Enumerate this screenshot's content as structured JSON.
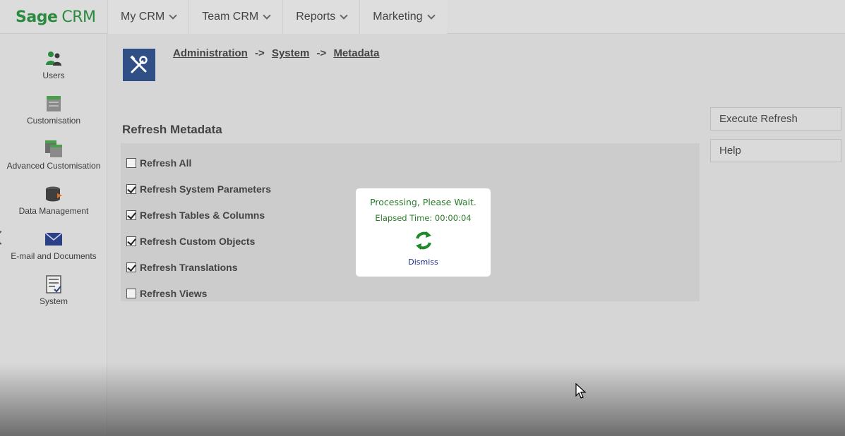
{
  "app": {
    "brand": "Sage",
    "brand_suffix": "CRM"
  },
  "nav": {
    "items": [
      {
        "label": "My CRM"
      },
      {
        "label": "Team CRM"
      },
      {
        "label": "Reports"
      },
      {
        "label": "Marketing"
      }
    ]
  },
  "sidebar": {
    "items": [
      {
        "label": "Users",
        "icon": "users-icon"
      },
      {
        "label": "Customisation",
        "icon": "customisation-icon"
      },
      {
        "label": "Advanced Customisation",
        "icon": "advanced-customisation-icon"
      },
      {
        "label": "Data Management",
        "icon": "data-management-icon"
      },
      {
        "label": "E-mail and Documents",
        "icon": "envelope-icon"
      },
      {
        "label": "System",
        "icon": "system-icon"
      }
    ]
  },
  "breadcrumb": {
    "items": [
      "Administration",
      "System",
      "Metadata"
    ],
    "separator": "->"
  },
  "section": {
    "title": "Refresh Metadata"
  },
  "options": [
    {
      "label": "Refresh All",
      "checked": false
    },
    {
      "label": "Refresh System Parameters",
      "checked": true
    },
    {
      "label": "Refresh Tables & Columns",
      "checked": true
    },
    {
      "label": "Refresh Custom Objects",
      "checked": true
    },
    {
      "label": "Refresh Translations",
      "checked": true
    },
    {
      "label": "Refresh Views",
      "checked": false
    }
  ],
  "actions": {
    "execute_label": "Execute Refresh",
    "help_label": "Help"
  },
  "modal": {
    "message": "Processing, Please Wait.",
    "elapsed": "Elapsed Time: 00:00:04",
    "dismiss_label": "Dismiss"
  },
  "colors": {
    "brand_green": "#2a8a3e",
    "admin_icon_bg": "#2f4f86",
    "spinner_green": "#1f8a2a",
    "dismiss_link": "#1b2d8f"
  }
}
